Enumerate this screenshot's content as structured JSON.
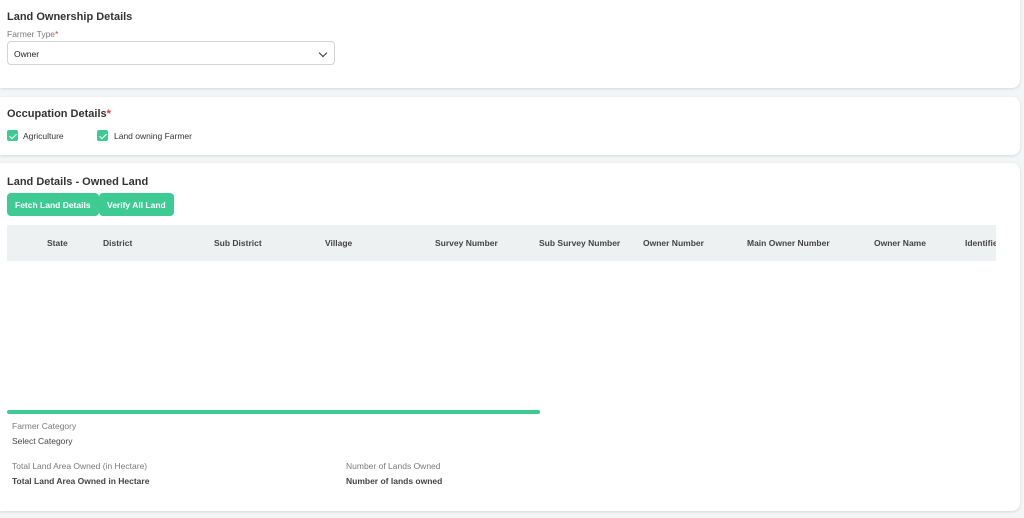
{
  "ownership": {
    "title": "Land Ownership Details",
    "farmer_type_label": "Farmer Type",
    "required_mark": "*",
    "farmer_type_value": "Owner"
  },
  "occupation": {
    "title": "Occupation Details",
    "required_mark": "*",
    "options": [
      {
        "label": "Agriculture",
        "checked": true
      },
      {
        "label": "Land owning Farmer",
        "checked": true
      }
    ]
  },
  "land": {
    "title": "Land Details - Owned Land",
    "buttons": {
      "fetch": "Fetch Land Details",
      "verify": "Verify All Land"
    },
    "columns": [
      "State",
      "District",
      "Sub District",
      "Village",
      "Survey Number",
      "Sub Survey Number",
      "Owner Number",
      "Main Owner Number",
      "Owner Name",
      "Identifier Na"
    ],
    "progress": 1.0,
    "farmer_category_label": "Farmer Category",
    "farmer_category_value": "Select Category",
    "total_area_label": "Total Land Area Owned (in Hectare)",
    "total_area_value": "Total Land Area Owned in Hectare",
    "num_lands_label": "Number of Lands Owned",
    "num_lands_value": "Number of lands owned"
  },
  "colors": {
    "accent": "#3ecb93",
    "required": "#e03131",
    "header_bg": "#eef1f2"
  },
  "icons": [
    "chevron-down-icon",
    "checkbox-checked-icon"
  ]
}
